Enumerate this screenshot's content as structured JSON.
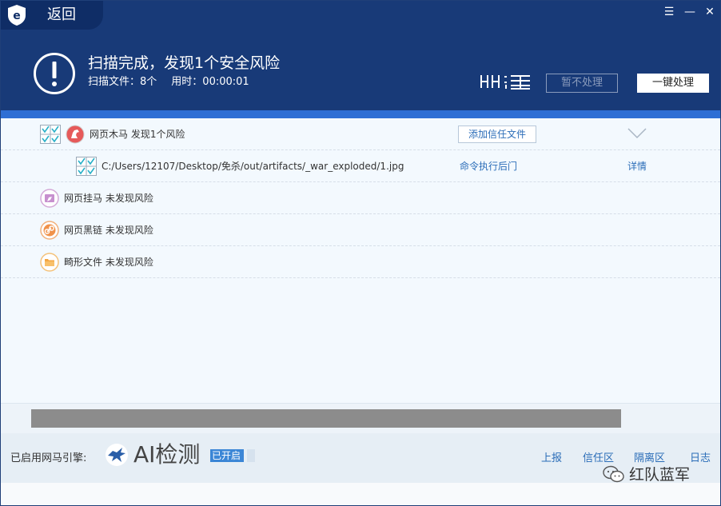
{
  "header": {
    "back_label": "返回",
    "headline": "扫描完成，发现1个安全风险",
    "scanned_files_label": "扫描文件：8个",
    "elapsed_label": "用时：",
    "elapsed_value": "00:00:01",
    "ignore_label": "暂不处理",
    "fix_all_label": "一键处理",
    "colors": {
      "header_bg": "#183a78",
      "accent_bar": "#2f6fd4"
    }
  },
  "results": {
    "webshell": {
      "label": "网页木马 发现1个风险",
      "add_trust_label": "添加信任文件",
      "item": {
        "path": "C:/Users/12107/Desktop/免杀/out/artifacts/_war_exploded/1.jpg",
        "threat_type": "命令执行后门",
        "detail_label": "详情"
      }
    },
    "web_trojan": {
      "label": "网页挂马 未发现风险"
    },
    "black_link": {
      "label": "网页黑链 未发现风险"
    },
    "malformed_file": {
      "label": "畸形文件 未发现风险"
    }
  },
  "progress": {
    "fraction": 1.0
  },
  "footer": {
    "engine_label": "已启用网马引擎:",
    "ai_label": "AI检测",
    "status_label": "已开启",
    "links": [
      "上报",
      "信任区",
      "隔离区",
      "日志"
    ]
  },
  "watermark": {
    "text": "红队蓝军"
  }
}
